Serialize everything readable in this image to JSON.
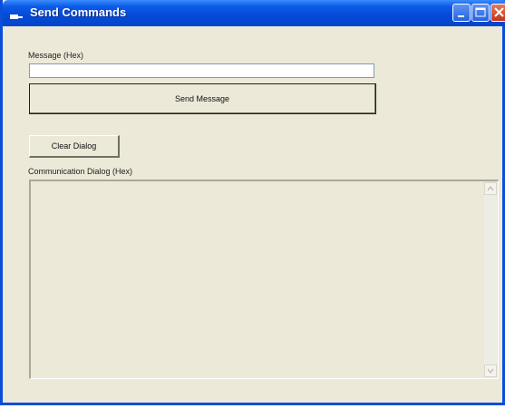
{
  "window": {
    "title": "Send Commands",
    "colors": {
      "titlebar": "#0549D8",
      "body": "#ECE9D8",
      "close": "#C2341A"
    }
  },
  "message": {
    "label": "Message (Hex)",
    "value": "",
    "send_button_label": "Send Message"
  },
  "dialog": {
    "clear_button_label": "Clear Dialog",
    "label": "Communication Dialog (Hex)",
    "content": ""
  },
  "icons": {
    "app": "app-icon",
    "minimize": "minimize-icon",
    "maximize": "maximize-icon",
    "close": "close-icon"
  }
}
